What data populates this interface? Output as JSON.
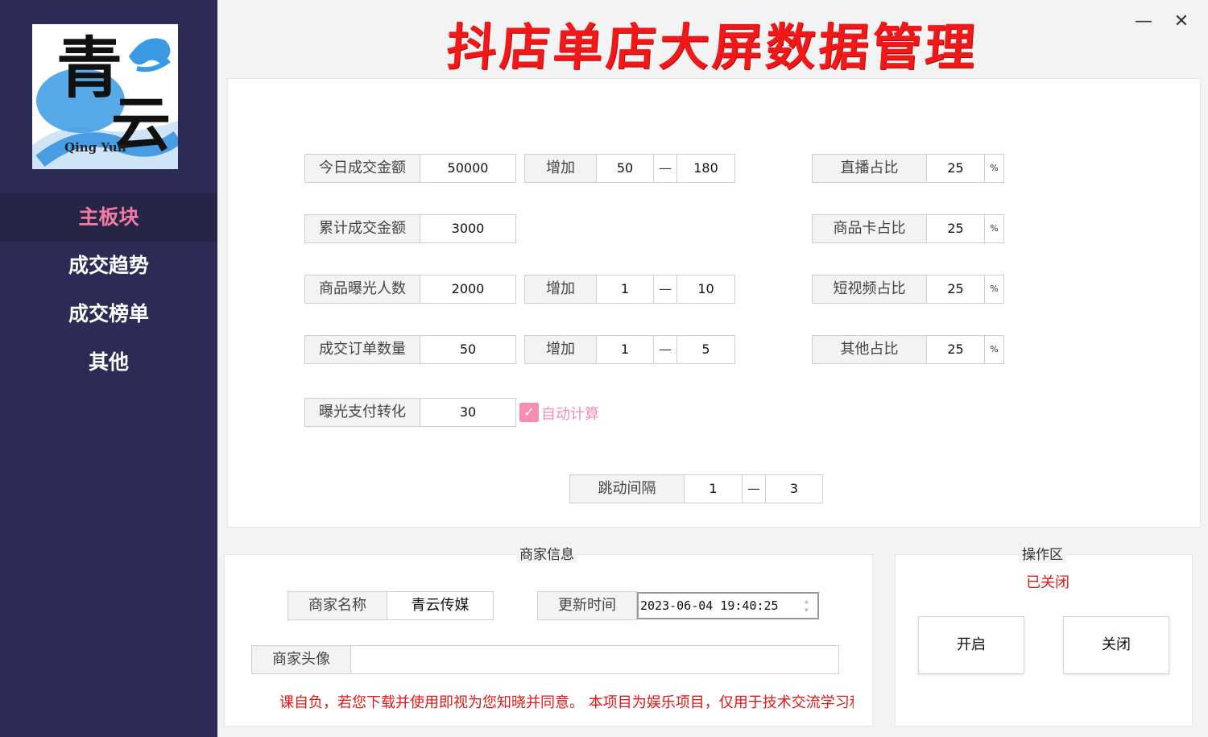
{
  "app": {
    "title": "抖店单店大屏数据管理",
    "minimize_glyph": "—",
    "close_glyph": "✕"
  },
  "logo": {
    "char1": "青",
    "char2": "云",
    "english": "Qing Yun"
  },
  "sidebar": {
    "items": [
      {
        "label": "主板块",
        "active": true
      },
      {
        "label": "成交趋势"
      },
      {
        "label": "成交榜单"
      },
      {
        "label": "其他"
      }
    ]
  },
  "metrics": {
    "today_amount": {
      "label": "今日成交金额",
      "value": "50000",
      "inc_label": "增加",
      "min": "50",
      "sep": "—",
      "max": "180"
    },
    "total_amount": {
      "label": "累计成交金额",
      "value": "3000"
    },
    "exposure": {
      "label": "商品曝光人数",
      "value": "2000",
      "inc_label": "增加",
      "min": "1",
      "sep": "—",
      "max": "10"
    },
    "orders": {
      "label": "成交订单数量",
      "value": "50",
      "inc_label": "增加",
      "min": "1",
      "sep": "—",
      "max": "5"
    },
    "conversion": {
      "label": "曝光支付转化",
      "value": "30",
      "auto_label": "自动计算",
      "auto_checked": true
    },
    "interval": {
      "label": "跳动间隔",
      "min": "1",
      "sep": "—",
      "max": "3"
    }
  },
  "ratios": [
    {
      "label": "直播占比",
      "value": "25",
      "unit": "%"
    },
    {
      "label": "商品卡占比",
      "value": "25",
      "unit": "%"
    },
    {
      "label": "短视频占比",
      "value": "25",
      "unit": "%"
    },
    {
      "label": "其他占比",
      "value": "25",
      "unit": "%"
    }
  ],
  "merchant": {
    "section_title": "商家信息",
    "name_label": "商家名称",
    "name_value": "青云传媒",
    "update_label": "更新时间",
    "update_value": "2023-06-04 19:40:25",
    "avatar_label": "商家头像",
    "avatar_value": "",
    "notice": "课自负，若您下载并使用即视为您知晓并同意。 本项目为娱乐项目，仅用于技术交流学习和"
  },
  "operations": {
    "section_title": "操作区",
    "status": "已关闭",
    "open_label": "开启",
    "close_label": "关闭"
  },
  "colors": {
    "sidebar_bg": "#2b2b55",
    "active_nav": "#f47aa1",
    "title_red": "#f01818",
    "accent_pink": "#f48fb1"
  }
}
